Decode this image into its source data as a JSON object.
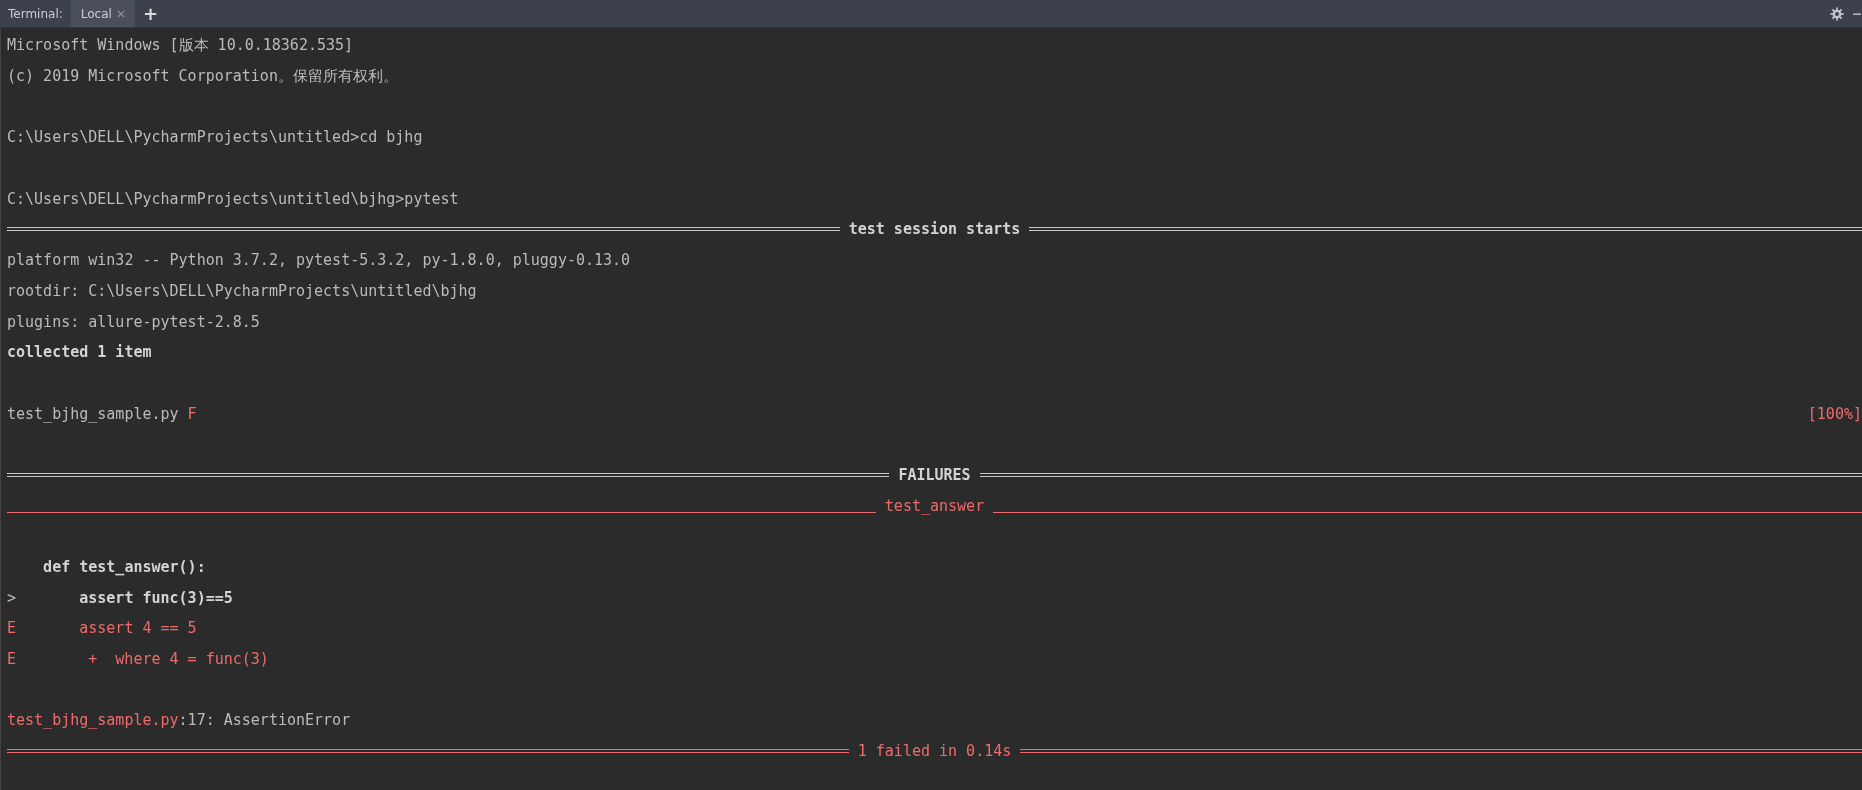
{
  "tabbar": {
    "label": "Terminal:",
    "tabs": [
      {
        "label": "Local",
        "selected": true
      }
    ],
    "add_button": "+"
  },
  "lines": [
    {
      "kind": "text",
      "text": "Microsoft Windows [版本 10.0.18362.535]"
    },
    {
      "kind": "text",
      "text": "(c) 2019 Microsoft Corporation。保留所有权利。"
    },
    {
      "kind": "blank"
    },
    {
      "kind": "text",
      "text": "C:\\Users\\DELL\\PycharmProjects\\untitled>cd bjhg"
    },
    {
      "kind": "blank"
    },
    {
      "kind": "text",
      "text": "C:\\Users\\DELL\\PycharmProjects\\untitled\\bjhg>pytest"
    },
    {
      "kind": "rule",
      "text": "test session starts"
    },
    {
      "kind": "text",
      "text": "platform win32 -- Python 3.7.2, pytest-5.3.2, py-1.8.0, pluggy-0.13.0"
    },
    {
      "kind": "text",
      "text": "rootdir: C:\\Users\\DELL\\PycharmProjects\\untitled\\bjhg"
    },
    {
      "kind": "text",
      "text": "plugins: allure-pytest-2.8.5"
    },
    {
      "kind": "bold",
      "text": "collected 1 item"
    },
    {
      "kind": "blank"
    },
    {
      "kind": "progress",
      "file": "test_bjhg_sample.py",
      "result": "F",
      "percent": "[100%]"
    },
    {
      "kind": "blank"
    },
    {
      "kind": "rule",
      "text": "FAILURES"
    },
    {
      "kind": "section",
      "text": "test_answer"
    },
    {
      "kind": "blank"
    },
    {
      "kind": "def",
      "text": "def test_answer():"
    },
    {
      "kind": "code",
      "marker": ">",
      "text": "assert func(3)==5",
      "error": false
    },
    {
      "kind": "code",
      "marker": "E",
      "text": "assert 4 == 5",
      "error": true
    },
    {
      "kind": "continuation",
      "marker": "E",
      "text": "+  where 4 = func(3)",
      "error": true
    },
    {
      "kind": "blank"
    },
    {
      "kind": "location",
      "file": "test_bjhg_sample.py",
      "text": ":17: AssertionError"
    },
    {
      "kind": "fail_rule",
      "text": "1 failed in 0.14s"
    }
  ]
}
